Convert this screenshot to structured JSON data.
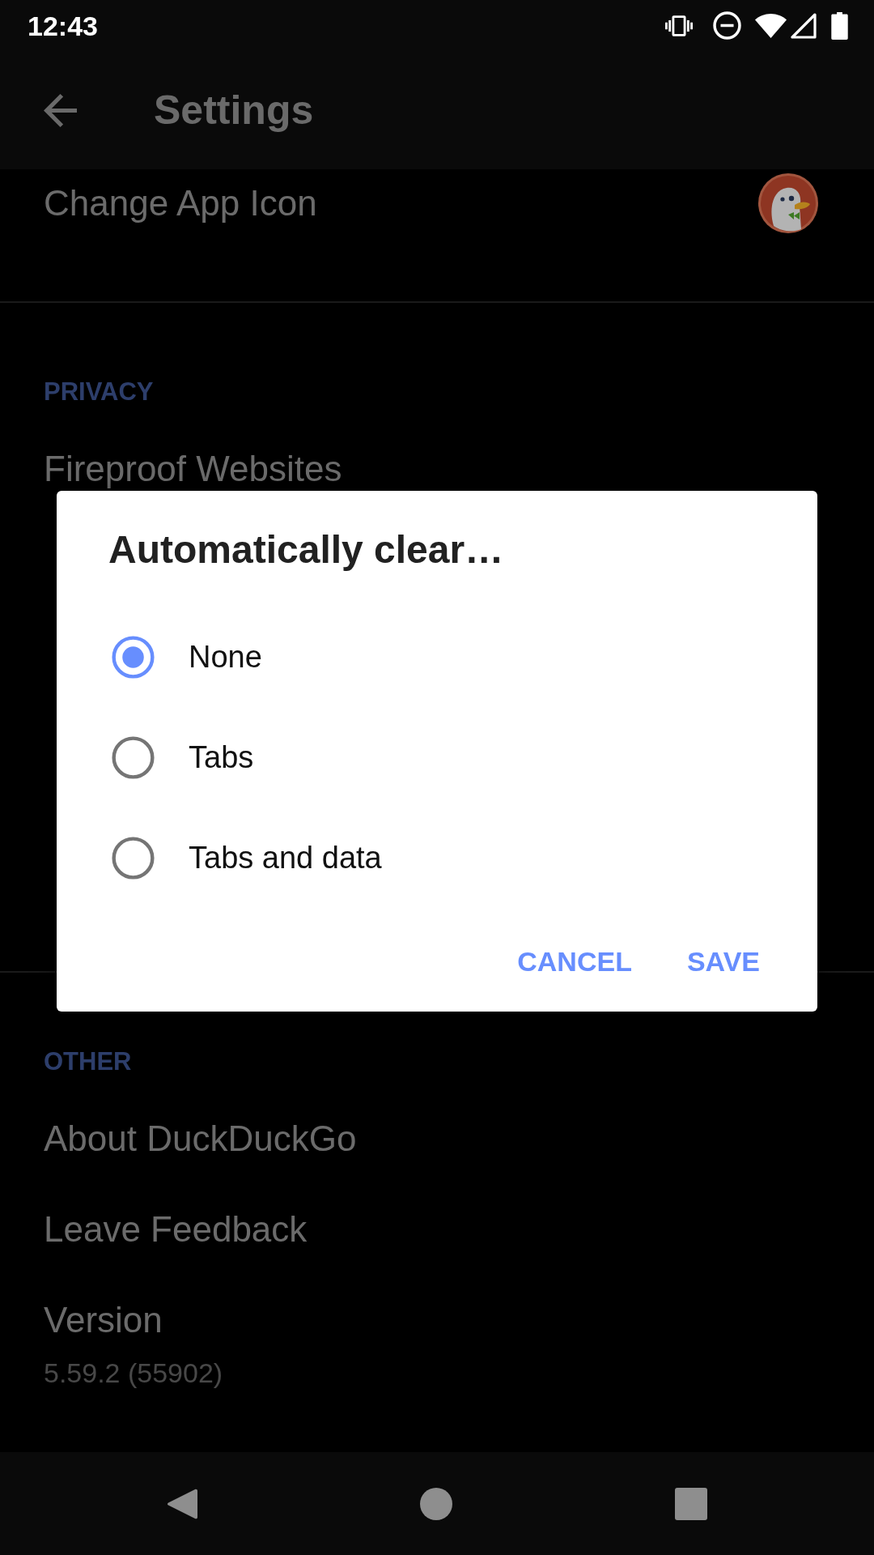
{
  "status_bar": {
    "time": "12:43"
  },
  "app_bar": {
    "title": "Settings"
  },
  "sections": [
    {
      "items": [
        {
          "kind": "app_icon",
          "title": "Change App Icon"
        }
      ]
    },
    {
      "header": "PRIVACY",
      "items": [
        {
          "kind": "text",
          "title": "Fireproof Websites"
        }
      ]
    },
    {
      "header": "OTHER",
      "items": [
        {
          "kind": "text",
          "title": "About DuckDuckGo"
        },
        {
          "kind": "text",
          "title": "Leave Feedback"
        },
        {
          "kind": "text",
          "title": "Version",
          "subtitle": "5.59.2 (55902)"
        }
      ]
    }
  ],
  "dialog": {
    "title": "Automatically clear…",
    "options": [
      {
        "label": "None",
        "selected": true
      },
      {
        "label": "Tabs",
        "selected": false
      },
      {
        "label": "Tabs and data",
        "selected": false
      }
    ],
    "buttons": [
      "CANCEL",
      "SAVE"
    ]
  }
}
